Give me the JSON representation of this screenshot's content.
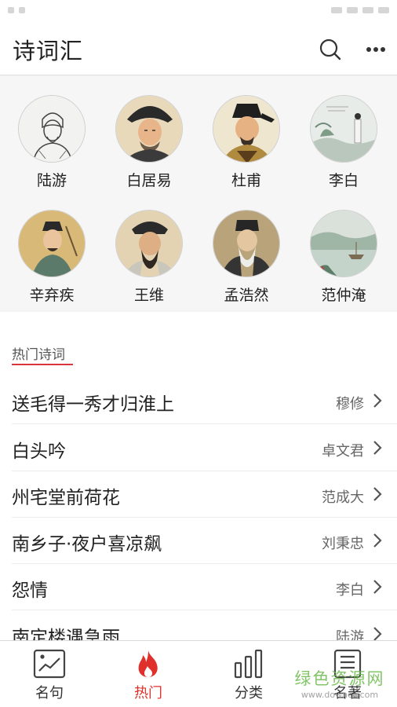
{
  "app": {
    "title": "诗词汇"
  },
  "toolbar": {
    "search_icon": "search-icon",
    "more_icon": "more-horizontal-icon"
  },
  "poets": [
    {
      "name": "陆游",
      "avatar": "portrait-sketch"
    },
    {
      "name": "白居易",
      "avatar": "portrait-painting"
    },
    {
      "name": "杜甫",
      "avatar": "portrait-painting"
    },
    {
      "name": "李白",
      "avatar": "landscape-painting"
    },
    {
      "name": "辛弃疾",
      "avatar": "portrait-painting"
    },
    {
      "name": "王维",
      "avatar": "portrait-painting"
    },
    {
      "name": "孟浩然",
      "avatar": "portrait-painting"
    },
    {
      "name": "范仲淹",
      "avatar": "landscape-painting"
    }
  ],
  "hot_section": {
    "title": "热门诗词",
    "accent_color": "#d9353f"
  },
  "poems": [
    {
      "title": "送毛得一秀才归淮上",
      "author": "穆修"
    },
    {
      "title": "白头吟",
      "author": "卓文君"
    },
    {
      "title": "州宅堂前荷花",
      "author": "范成大"
    },
    {
      "title": "南乡子·夜户喜凉飙",
      "author": "刘秉忠"
    },
    {
      "title": "怨情",
      "author": "李白"
    },
    {
      "title": "南定楼遇急雨",
      "author": "陆游"
    }
  ],
  "nav": {
    "active_color": "#e0302b",
    "items": [
      {
        "label": "名句",
        "icon": "image-chart-icon"
      },
      {
        "label": "热门",
        "icon": "flame-icon"
      },
      {
        "label": "分类",
        "icon": "bar-chart-icon"
      },
      {
        "label": "名著",
        "icon": "book-icon"
      }
    ]
  },
  "watermark": {
    "main": "绿色资源网",
    "sub": "www.downcc.com"
  }
}
